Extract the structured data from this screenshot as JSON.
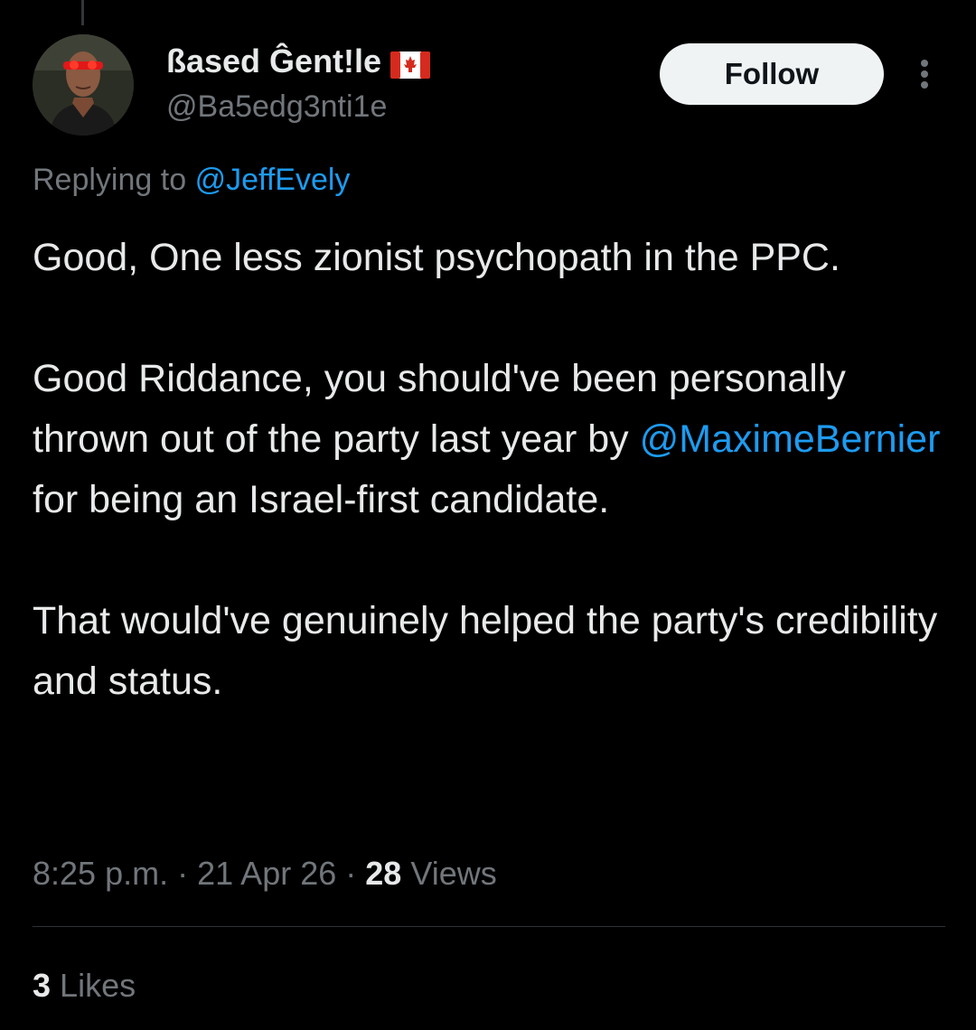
{
  "author": {
    "display_name": "ßased Ĝent!le",
    "flag_icon": "canada-flag-icon",
    "handle": "@Ba5edg3nti1e",
    "avatar_icon": "profile-avatar"
  },
  "actions": {
    "follow_label": "Follow",
    "more_icon": "more-vertical-icon"
  },
  "reply_context": {
    "prefix": "Replying to",
    "mention": "@JeffEvely"
  },
  "tweet": {
    "paragraph_1": "Good, One less zionist psychopath in the PPC.",
    "paragraph_2_before": "Good Riddance, you should've been personally thrown out of the party last year by ",
    "paragraph_2_mention": "@MaximeBernier",
    "paragraph_2_after": " for being an Israel-first candidate.",
    "paragraph_3": "That would've genuinely helped the party's credibility and status."
  },
  "meta": {
    "time": "8:25 p.m.",
    "separator": "·",
    "date": "21 Apr 26",
    "views_count": "28",
    "views_label": "Views"
  },
  "engagement": {
    "likes_count": "3",
    "likes_label": "Likes"
  },
  "colors": {
    "background": "#000000",
    "primary_text": "#e7e9ea",
    "secondary_text": "#71767b",
    "link": "#1d9bf0",
    "follow_button_bg": "#eff3f4",
    "divider": "#2f3336"
  }
}
